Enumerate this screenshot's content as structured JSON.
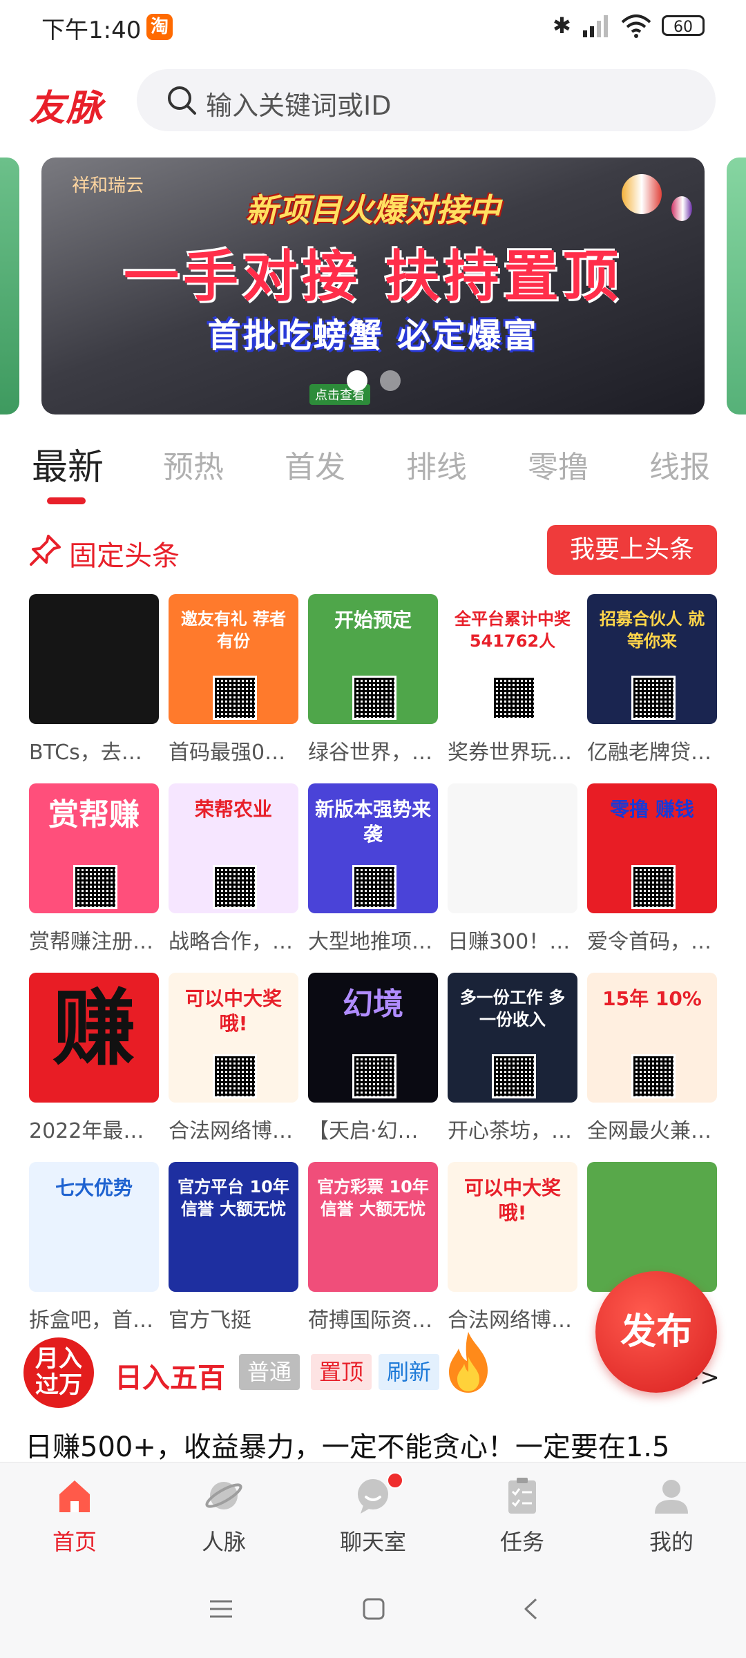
{
  "status_bar": {
    "time": "下午1:40",
    "app_badge": "淘",
    "battery": "60"
  },
  "header": {
    "logo": "友脉",
    "search_placeholder": "输入关键词或ID"
  },
  "banner": {
    "brand": "祥和瑞云",
    "line1": "新项目火爆对接中",
    "line2": "一手对接 扶持置顶",
    "line3": "首批吃螃蟹 必定爆富",
    "button": "点击查看",
    "active_dot": 0
  },
  "tabs": [
    "最新",
    "预热",
    "首发",
    "排线",
    "零撸",
    "线报"
  ],
  "section": {
    "title": "固定头条",
    "cta": "我要上头条"
  },
  "grid": [
    {
      "caption": "BTCs，去…",
      "tile_text": "",
      "bg": "#151515",
      "fg": "#f0c060"
    },
    {
      "caption": "首码最强0…",
      "tile_text": "邀友有礼 荐者有份",
      "bg": "#ff7a2c",
      "fg": "#ffffff"
    },
    {
      "caption": "绿谷世界，…",
      "tile_text": "开始预定",
      "bg": "#4fa64a",
      "fg": "#ffffff"
    },
    {
      "caption": "奖券世界玩…",
      "tile_text": "全平台累计中奖 541762人",
      "bg": "#ffffff",
      "fg": "#e8202a"
    },
    {
      "caption": "亿融老牌贷…",
      "tile_text": "招募合伙人 就等你来",
      "bg": "#1a2550",
      "fg": "#ffd54a"
    },
    {
      "caption": "赏帮赚注册…",
      "tile_text": "赏帮赚",
      "bg": "#ff4f7b",
      "fg": "#ffffff"
    },
    {
      "caption": "战略合作，…",
      "tile_text": "荣帮农业",
      "bg": "#f6e6ff",
      "fg": "#e8202a"
    },
    {
      "caption": "大型地推项…",
      "tile_text": "新版本强势来袭",
      "bg": "#4a43d8",
      "fg": "#ffffff"
    },
    {
      "caption": "日赚300！…",
      "tile_text": "",
      "bg": "#f7f7f7",
      "fg": "#333333"
    },
    {
      "caption": "爱令首码，…",
      "tile_text": "零撸 赚钱",
      "bg": "#e81d25",
      "fg": "#1a3ad6"
    },
    {
      "caption": "2022年最…",
      "tile_text": "赚",
      "bg": "#e81d25",
      "fg": "#111111"
    },
    {
      "caption": "合法网络博…",
      "tile_text": "可以中大奖哦!",
      "bg": "#fff5e8",
      "fg": "#e8202a"
    },
    {
      "caption": "【天启·幻…",
      "tile_text": "幻境",
      "bg": "#0a0a12",
      "fg": "#b08cff"
    },
    {
      "caption": "开心茶坊，…",
      "tile_text": "多一份工作 多一份收入",
      "bg": "#1a2338",
      "fg": "#ffffff"
    },
    {
      "caption": "全网最火兼…",
      "tile_text": "15年 10%",
      "bg": "#ffefe0",
      "fg": "#e8202a"
    },
    {
      "caption": "拆盒吧，首…",
      "tile_text": "七大优势",
      "bg": "#eaf3ff",
      "fg": "#1e62d0"
    },
    {
      "caption": "官方飞挺",
      "tile_text": "官方平台 10年信誉 大额无忧",
      "bg": "#1e2fa0",
      "fg": "#ffffff"
    },
    {
      "caption": "荷搏国际资…",
      "tile_text": "官方彩票 10年信誉 大额无忧",
      "bg": "#f04e7a",
      "fg": "#ffffff"
    },
    {
      "caption": "合法网络博…",
      "tile_text": "可以中大奖哦!",
      "bg": "#fff5e8",
      "fg": "#e8202a"
    },
    {
      "caption": "",
      "tile_text": "",
      "bg": "#58a84a",
      "fg": "#ffffff"
    }
  ],
  "post": {
    "avatar_text": "月入过万",
    "name": "日入五百",
    "badges": [
      "普通",
      "置顶",
      "刷新"
    ],
    "detail": "详情 >>",
    "text": "日赚500+，收益暴力，一定不能贪心！一定要在1.5"
  },
  "fab": {
    "label": "发布"
  },
  "bottom_nav": [
    {
      "label": "首页",
      "icon": "home-icon",
      "active": true
    },
    {
      "label": "人脉",
      "icon": "planet-icon",
      "active": false
    },
    {
      "label": "聊天室",
      "icon": "chat-icon",
      "active": false,
      "dot": true
    },
    {
      "label": "任务",
      "icon": "clipboard-icon",
      "active": false
    },
    {
      "label": "我的",
      "icon": "profile-icon",
      "active": false
    }
  ],
  "colors": {
    "brand_red": "#e8202a",
    "tab_inactive": "#b0b0b0"
  }
}
